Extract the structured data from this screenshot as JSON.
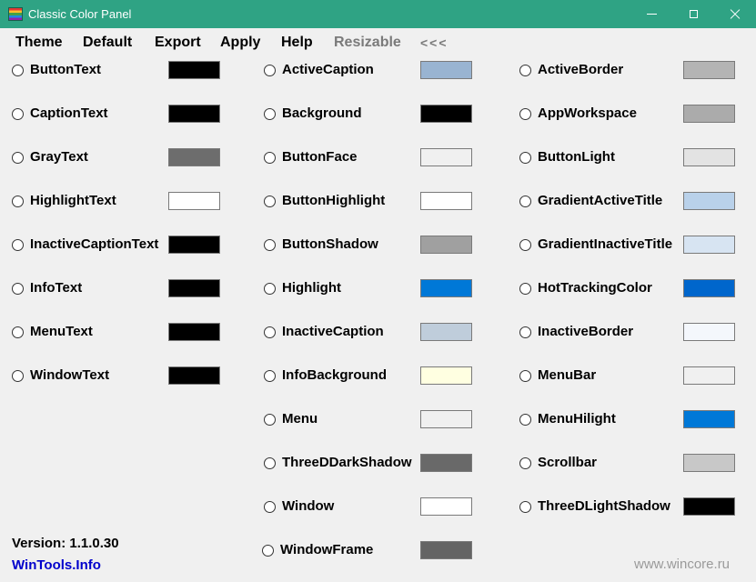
{
  "window": {
    "title": "Classic Color Panel",
    "icon": "rainbow-palette-icon",
    "controls": [
      "minimize-icon",
      "maximize-icon",
      "close-icon"
    ]
  },
  "menu": {
    "items": [
      "Theme",
      "Default",
      "Export",
      "Apply",
      "Help",
      "Resizable",
      "<<<"
    ]
  },
  "columns": [
    {
      "items": [
        {
          "name": "ButtonText",
          "color": "#000000"
        },
        {
          "name": "CaptionText",
          "color": "#000000"
        },
        {
          "name": "GrayText",
          "color": "#6d6d6d"
        },
        {
          "name": "HighlightText",
          "color": "#ffffff"
        },
        {
          "name": "InactiveCaptionText",
          "color": "#000000"
        },
        {
          "name": "InfoText",
          "color": "#000000"
        },
        {
          "name": "MenuText",
          "color": "#000000"
        },
        {
          "name": "WindowText",
          "color": "#000000"
        }
      ]
    },
    {
      "items": [
        {
          "name": "ActiveCaption",
          "color": "#99b4d1"
        },
        {
          "name": "Background",
          "color": "#000000"
        },
        {
          "name": "ButtonFace",
          "color": "#f0f0f0"
        },
        {
          "name": "ButtonHighlight",
          "color": "#ffffff"
        },
        {
          "name": "ButtonShadow",
          "color": "#a0a0a0"
        },
        {
          "name": "Highlight",
          "color": "#0078d7"
        },
        {
          "name": "InactiveCaption",
          "color": "#bfcddb"
        },
        {
          "name": "InfoBackground",
          "color": "#ffffe1"
        },
        {
          "name": "Menu",
          "color": "#f0f0f0"
        },
        {
          "name": "ThreeDDarkShadow",
          "color": "#696969"
        },
        {
          "name": "Window",
          "color": "#ffffff"
        },
        {
          "name": "WindowFrame",
          "color": "#646464"
        }
      ]
    },
    {
      "items": [
        {
          "name": "ActiveBorder",
          "color": "#b4b4b4"
        },
        {
          "name": "AppWorkspace",
          "color": "#ababab"
        },
        {
          "name": "ButtonLight",
          "color": "#e3e3e3"
        },
        {
          "name": "GradientActiveTitle",
          "color": "#b9d1ea"
        },
        {
          "name": "GradientInactiveTitle",
          "color": "#d7e4f2"
        },
        {
          "name": "HotTrackingColor",
          "color": "#0066cc"
        },
        {
          "name": "InactiveBorder",
          "color": "#f4f7fc"
        },
        {
          "name": "MenuBar",
          "color": "#f0f0f0"
        },
        {
          "name": "MenuHilight",
          "color": "#0078d7"
        },
        {
          "name": "Scrollbar",
          "color": "#c8c8c8"
        },
        {
          "name": "ThreeDLightShadow",
          "color": "#000000"
        }
      ]
    }
  ],
  "footer": {
    "version": "Version: 1.1.0.30",
    "link": "WinTools.Info",
    "watermark": "www.wincore.ru"
  }
}
